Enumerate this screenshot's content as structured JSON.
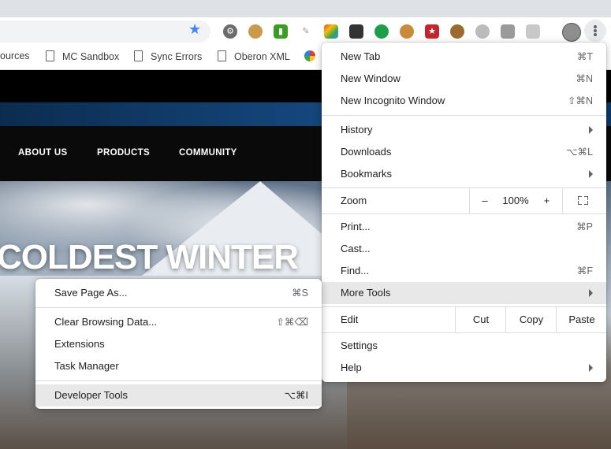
{
  "browser": {
    "bookmarks": [
      {
        "label": "ources"
      },
      {
        "label": "MC Sandbox"
      },
      {
        "label": "Sync Errors"
      },
      {
        "label": "Oberon XML"
      }
    ],
    "extension_icons": [
      "gear-extension-icon",
      "cookie-extension-icon",
      "chart-extension-icon",
      "pen-extension-icon",
      "rainbow-extension-icon",
      "mask-extension-icon",
      "green-chat-extension-icon",
      "cookie2-extension-icon",
      "red-star-extension-icon",
      "cookie3-extension-icon",
      "grey-circle-extension-icon",
      "grey-box-extension-icon",
      "grey-chat-extension-icon"
    ]
  },
  "site": {
    "nav": [
      "ABOUT US",
      "PRODUCTS",
      "COMMUNITY"
    ],
    "hero_title": "COLDEST WINTER"
  },
  "menu": {
    "new_tab": {
      "label": "New Tab",
      "shortcut": "⌘T"
    },
    "new_window": {
      "label": "New Window",
      "shortcut": "⌘N"
    },
    "new_incognito": {
      "label": "New Incognito Window",
      "shortcut": "⇧⌘N"
    },
    "history": {
      "label": "History"
    },
    "downloads": {
      "label": "Downloads",
      "shortcut": "⌥⌘L"
    },
    "bookmarks": {
      "label": "Bookmarks"
    },
    "zoom": {
      "label": "Zoom",
      "minus": "–",
      "value": "100%",
      "plus": "+"
    },
    "print": {
      "label": "Print...",
      "shortcut": "⌘P"
    },
    "cast": {
      "label": "Cast..."
    },
    "find": {
      "label": "Find...",
      "shortcut": "⌘F"
    },
    "more_tools": {
      "label": "More Tools"
    },
    "edit": {
      "label": "Edit",
      "cut": "Cut",
      "copy": "Copy",
      "paste": "Paste"
    },
    "settings": {
      "label": "Settings"
    },
    "help": {
      "label": "Help"
    }
  },
  "submenu": {
    "save_page": {
      "label": "Save Page As...",
      "shortcut": "⌘S"
    },
    "clear_data": {
      "label": "Clear Browsing Data...",
      "shortcut": "⇧⌘⌫"
    },
    "extensions": {
      "label": "Extensions"
    },
    "task_manager": {
      "label": "Task Manager"
    },
    "dev_tools": {
      "label": "Developer Tools",
      "shortcut": "⌥⌘I"
    }
  },
  "colors": {
    "accent": "#4285f4",
    "menu_highlight": "#e8e8e8"
  }
}
